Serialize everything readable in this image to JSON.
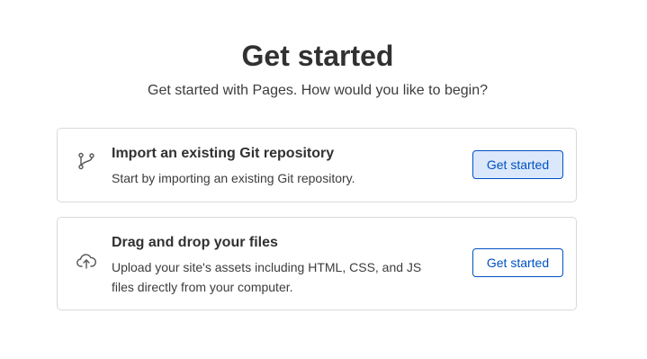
{
  "header": {
    "title": "Get started",
    "subtitle": "Get started with Pages. How would you like to begin?"
  },
  "options": [
    {
      "icon": "git-branch-icon",
      "title": "Import an existing Git repository",
      "description": "Start by importing an existing Git repository.",
      "button_label": "Get started",
      "button_state": "hover"
    },
    {
      "icon": "cloud-upload-icon",
      "title": "Drag and drop your files",
      "description": "Upload your site's assets including HTML, CSS, and JS files directly from your computer.",
      "button_label": "Get started",
      "button_state": "default"
    }
  ],
  "colors": {
    "accent": "#0051c3",
    "button_hover_bg": "#dbe8fb",
    "card_border": "#d9d9d9",
    "text": "#313131"
  }
}
